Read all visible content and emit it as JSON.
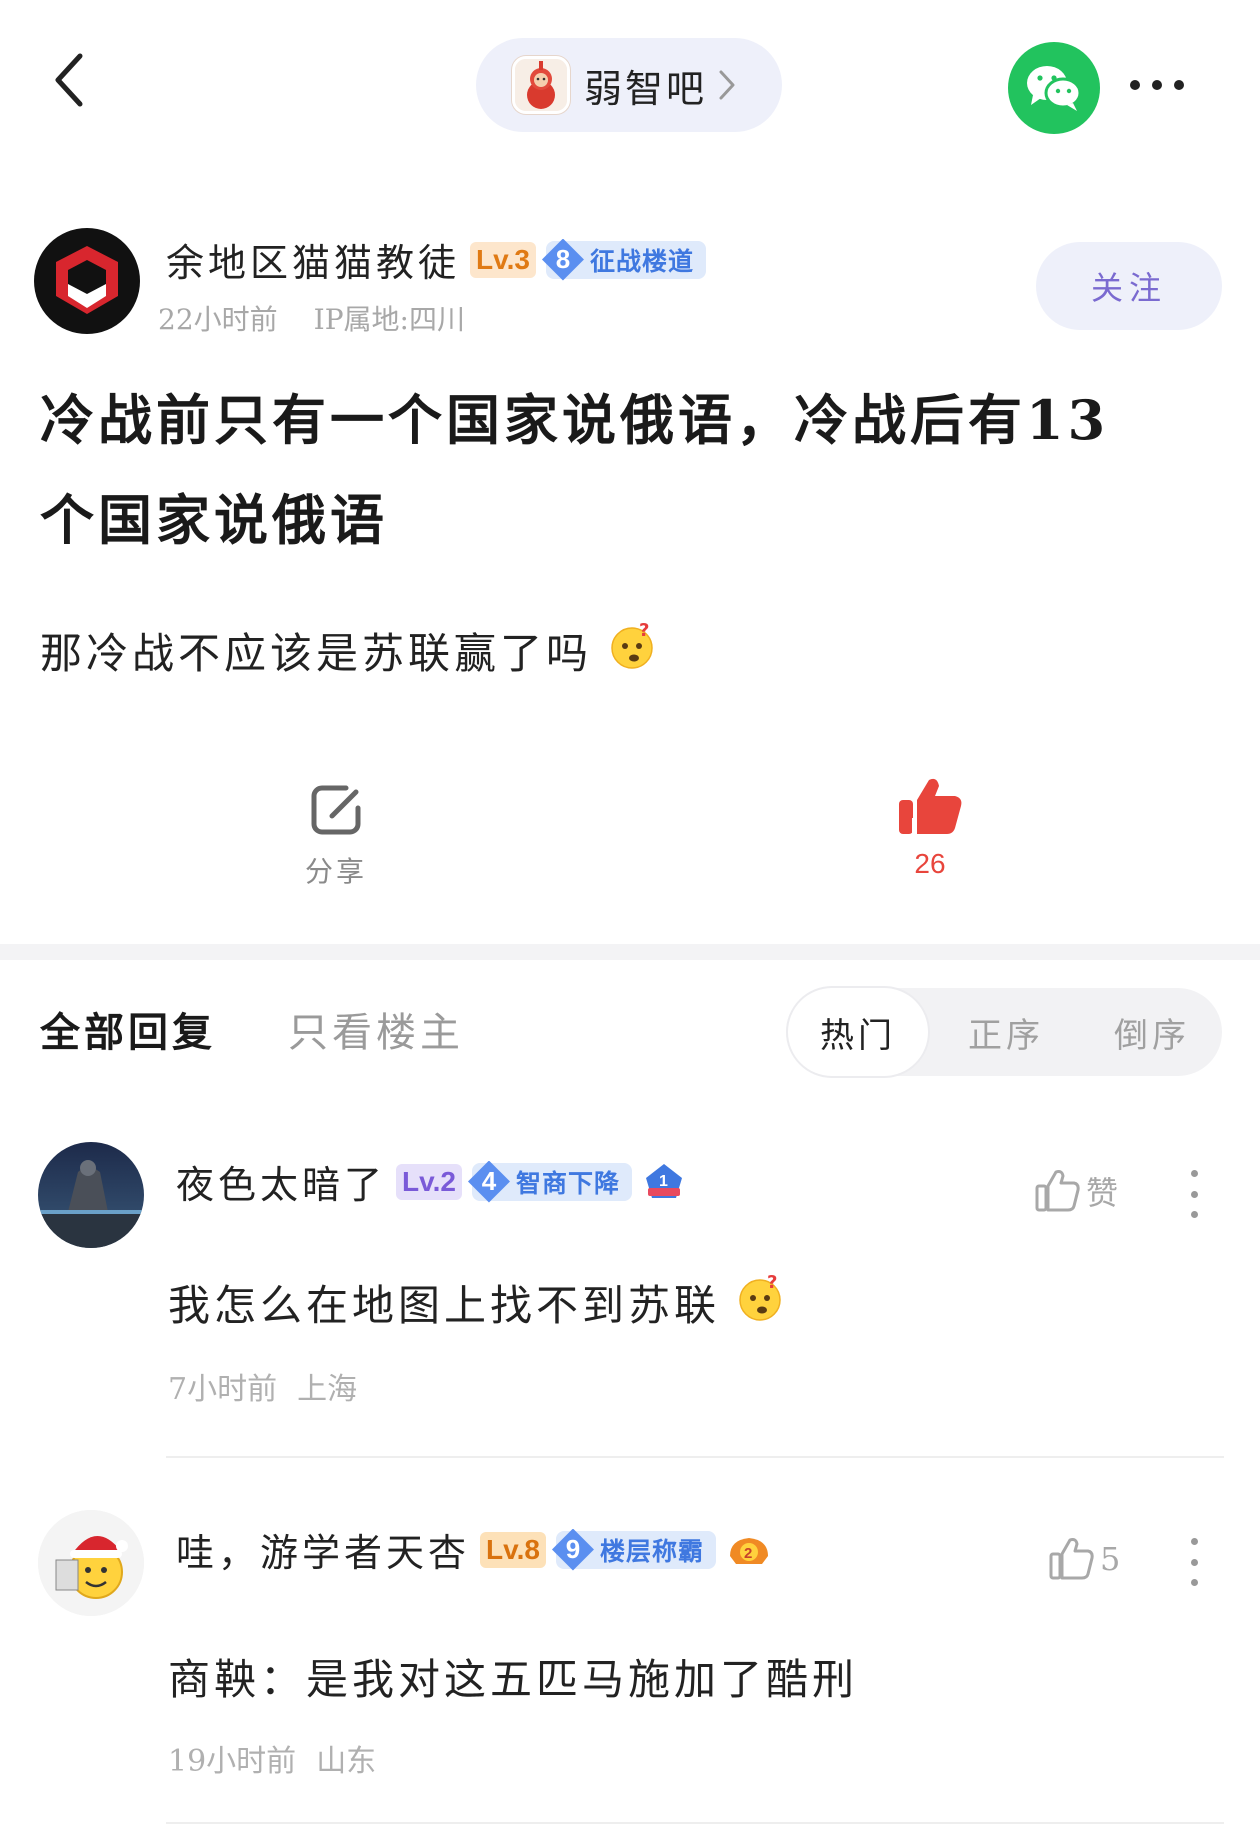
{
  "header": {
    "forum_name": "弱智吧"
  },
  "post": {
    "author": {
      "name": "余地区猫猫教徒",
      "level": "Lv.3",
      "title_num": "8",
      "title_text": "征战楼道",
      "time": "22小时前",
      "ip": "IP属地:四川",
      "follow_label": "关注"
    },
    "title_line1": "冷战前只有一个国家说俄语，冷战后有13",
    "title_line2": "个国家说俄语",
    "body": "那冷战不应该是苏联赢了吗",
    "share_label": "分享",
    "like_count": "26"
  },
  "tabs": {
    "all_replies": "全部回复",
    "only_op": "只看楼主",
    "sort_hot": "热门",
    "sort_asc": "正序",
    "sort_desc": "倒序"
  },
  "replies": [
    {
      "name": "夜色太暗了",
      "level": "Lv.2",
      "title_num": "4",
      "title_text": "智商下降",
      "like_label": "赞",
      "text": "我怎么在地图上找不到苏联",
      "time": "7小时前",
      "location": "上海"
    },
    {
      "name": "哇，游学者天杏",
      "level": "Lv.8",
      "title_num": "9",
      "title_text": "楼层称霸",
      "like_label": "5",
      "text": "商鞅：是我对这五匹马施加了酷刑",
      "time": "19小时前",
      "location": "山东"
    }
  ],
  "colors": {
    "like_red": "#e8453c",
    "wechat_green": "#22c35e",
    "badge_blue": "#5b8ff0"
  }
}
